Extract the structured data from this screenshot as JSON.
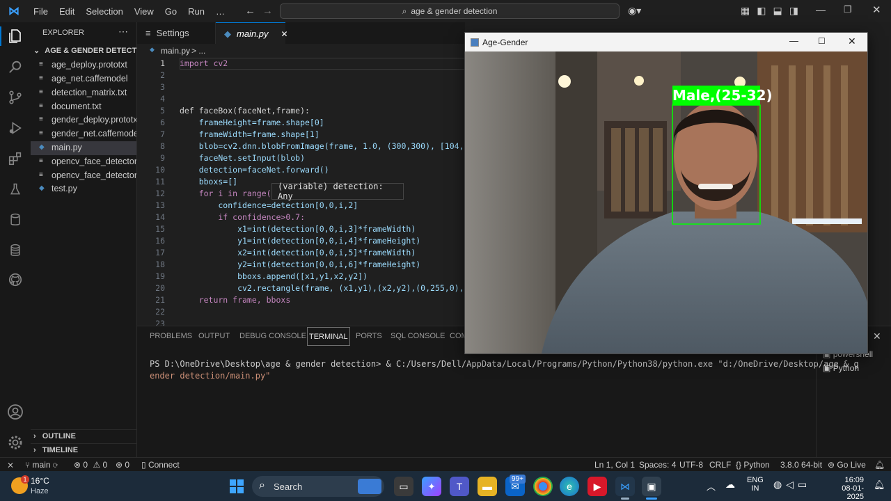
{
  "menubar": {
    "items": [
      "File",
      "Edit",
      "Selection",
      "View",
      "Go",
      "Run",
      "…"
    ],
    "search": "age & gender detection"
  },
  "explorer": {
    "title": "EXPLORER",
    "folder": "AGE & GENDER DETECTION",
    "files": [
      "age_deploy.prototxt",
      "age_net.caffemodel",
      "detection_matrix.txt",
      "document.txt",
      "gender_deploy.prototxt",
      "gender_net.caffemodel",
      "main.py",
      "opencv_face_detector...",
      "opencv_face_detector...",
      "test.py"
    ],
    "outline": "OUTLINE",
    "timeline": "TIMELINE"
  },
  "tabs": [
    "Settings",
    "main.py"
  ],
  "breadcrumb": {
    "file": "main.py",
    "rest": "> ..."
  },
  "code": {
    "line_numbers": [
      "1",
      "2",
      "3",
      "4",
      "5",
      "6",
      "7",
      "8",
      "9",
      "10",
      "11",
      "12",
      "13",
      "14",
      "15",
      "16",
      "17",
      "18",
      "19",
      "20",
      "21",
      "22",
      "23"
    ],
    "lines": [
      "import cv2",
      "",
      "",
      "",
      "def faceBox(faceNet,frame):",
      "    frameHeight=frame.shape[0]",
      "    frameWidth=frame.shape[1]",
      "    blob=cv2.dnn.blobFromImage(frame, 1.0, (300,300), [104,",
      "    faceNet.setInput(blob)",
      "    detection=faceNet.forward()",
      "    bboxs=[]",
      "    for i in range(",
      "        confidence=detection[0,0,i,2]",
      "        if confidence>0.7:",
      "            x1=int(detection[0,0,i,3]*frameWidth)",
      "            y1=int(detection[0,0,i,4]*frameHeight)",
      "            x2=int(detection[0,0,i,5]*frameWidth)",
      "            y2=int(detection[0,0,i,6]*frameHeight)",
      "            bboxs.append([x1,y1,x2,y2])",
      "            cv2.rectangle(frame, (x1,y1),(x2,y2),(0,255,0),",
      "    return frame, bboxs",
      "",
      ""
    ],
    "tooltip": "(variable) detection: Any"
  },
  "panel": {
    "tabs": [
      "PROBLEMS",
      "OUTPUT",
      "DEBUG CONSOLE",
      "TERMINAL",
      "PORTS",
      "SQL CONSOLE",
      "COM"
    ],
    "active_tab": "TERMINAL",
    "terminal_line1": "PS D:\\OneDrive\\Desktop\\age & gender detection> & C:/Users/Dell/AppData/Local/Programs/Python/Python38/python.exe \"d:/OneDrive/Desktop/age & g",
    "terminal_line2": "ender detection/main.py\"",
    "shells": [
      "powershell",
      "Python"
    ]
  },
  "statusbar": {
    "branch": "main",
    "errors": "0",
    "warnings": "0",
    "ports": "0",
    "connect": "Connect",
    "position": "Ln 1, Col 1",
    "spaces": "Spaces: 4",
    "encoding": "UTF-8",
    "eol": "CRLF",
    "language": "Python",
    "interpreter": "3.8.0 64-bit",
    "golive": "Go Live"
  },
  "agewindow": {
    "title": "Age-Gender",
    "label": "Male,(25-32)"
  },
  "taskbar": {
    "temp": "16°C",
    "weather": "Haze",
    "weather_badge": "1",
    "search": "Search",
    "mail_badge": "99+",
    "lang": "ENG",
    "region": "IN",
    "time": "16:09",
    "date": "08-01-2025"
  },
  "colors": {
    "accent": "#0078d4",
    "label_bg": "#00ff00",
    "editor_bg": "#1f1f1f"
  }
}
